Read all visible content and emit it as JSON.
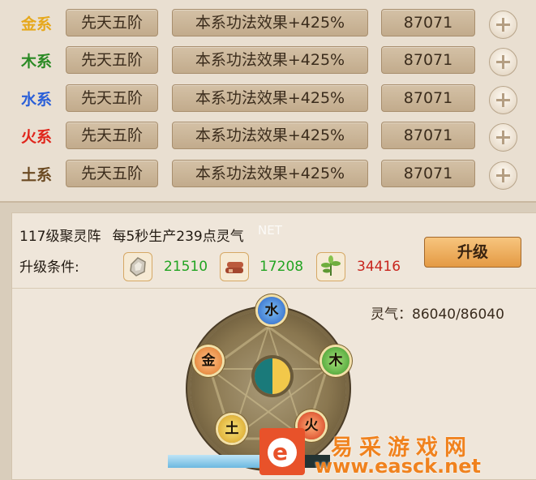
{
  "elements": [
    {
      "label": "金系",
      "color": "#e6a81c",
      "rank": "先天五阶",
      "effect": "本系功法效果+425%",
      "value": "87071"
    },
    {
      "label": "木系",
      "color": "#2a8a24",
      "rank": "先天五阶",
      "effect": "本系功法效果+425%",
      "value": "87071"
    },
    {
      "label": "水系",
      "color": "#2a5fd8",
      "rank": "先天五阶",
      "effect": "本系功法效果+425%",
      "value": "87071"
    },
    {
      "label": "火系",
      "color": "#e0261c",
      "rank": "先天五阶",
      "effect": "本系功法效果+425%",
      "value": "87071"
    },
    {
      "label": "土系",
      "color": "#6b4a22",
      "rank": "先天五阶",
      "effect": "本系功法效果+425%",
      "value": "87071"
    }
  ],
  "array": {
    "level_name": "117级聚灵阵",
    "production": "每5秒生产239点灵气",
    "requirement_label": "升级条件:",
    "resources": [
      {
        "icon": "ore-icon",
        "value": "21510",
        "color": "#22a422"
      },
      {
        "icon": "wood-icon",
        "value": "17208",
        "color": "#22a422"
      },
      {
        "icon": "herb-icon",
        "value": "34416",
        "color": "#c8261e"
      }
    ],
    "upgrade_label": "升级",
    "lingqi_text": "灵气：86040/86040"
  },
  "wheel": {
    "nodes": [
      "水",
      "木",
      "火",
      "土",
      "金"
    ],
    "progress_fraction": 0.6
  },
  "watermark": {
    "net_text": "NET",
    "logo_letter": "e",
    "title": "易采游戏网",
    "url": "www.easck.net"
  }
}
